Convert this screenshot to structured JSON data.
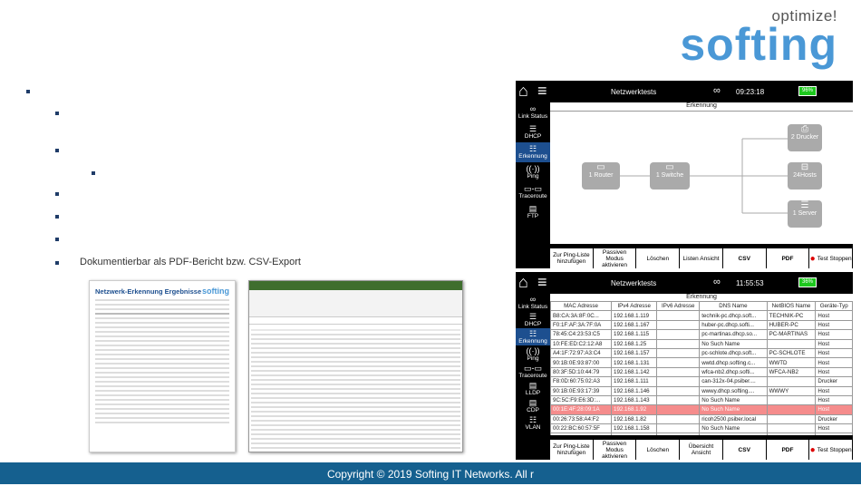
{
  "logo": {
    "tagline": "optimize!",
    "brand": "softing"
  },
  "slide": {
    "visible_bullet": "Dokumentierbar als PDF-Bericht bzw. CSV-Export"
  },
  "footer": {
    "text": "Copyright © 2019 Softing IT Networks. All r"
  },
  "report": {
    "title": "Netzwerk-Erkennung Ergebnisse",
    "brand": "softing"
  },
  "screen1": {
    "title": "Netzwerktests",
    "time": "09:23:18",
    "battery": "96%",
    "subtitle": "Erkennung",
    "sidebar": [
      "Link Status",
      "DHCP",
      "Erkennung",
      "Ping",
      "Traceroute",
      "FTP"
    ],
    "nodes": {
      "router": "1 Router",
      "switch": "1 Switche",
      "printer": "2 Drucker",
      "hosts": "24Hosts",
      "server": "1 Server"
    },
    "buttons": [
      "Zur Ping-Liste hinzufügen",
      "Passiven Modus aktivieren",
      "Löschen",
      "Listen Ansicht",
      "CSV",
      "PDF",
      "Test Stoppen"
    ]
  },
  "screen2": {
    "title": "Netzwerktests",
    "time": "11:55:53",
    "battery": "36%",
    "subtitle": "Erkennung",
    "sidebar": [
      "Link Status",
      "DHCP",
      "Erkennung",
      "Ping",
      "Traceroute",
      "LLDP",
      "CDP",
      "VLAN"
    ],
    "columns": [
      "MAC Adresse",
      "IPv4 Adresse",
      "IPv6 Adresse",
      "DNS Name",
      "NetBIOS Name",
      "Geräte-Typ"
    ],
    "rows": [
      [
        "B8:CA:3A:8F:0C...",
        "192.168.1.119",
        "",
        "technik-pc.dhcp.soft...",
        "TECHNIK-PC",
        "Host"
      ],
      [
        "F0:1F:AF:3A:7F:0A",
        "192.168.1.167",
        "",
        "huber-pc.dhcp.softi...",
        "HUBER-PC",
        "Host"
      ],
      [
        "78:45:C4:23:53:C5",
        "192.168.1.115",
        "",
        "pc-martinas.dhcp.so...",
        "PC-MARTINAS",
        "Host"
      ],
      [
        "10:FE:ED:C2:12:A8",
        "192.168.1.25",
        "",
        "No Such Name",
        "",
        "Host"
      ],
      [
        "A4:1F:72:97:A3:C4",
        "192.168.1.157",
        "",
        "pc-schlote.dhcp.soft...",
        "PC-SCHLOTE",
        "Host"
      ],
      [
        "90:1B:0E:93:87:00",
        "192.168.1.131",
        "",
        "wwtd.dhcp.softing.c...",
        "WWTD",
        "Host"
      ],
      [
        "80:3F:5D:10:44:79",
        "192.168.1.142",
        "",
        "wfca-nb2.dhcp.softi...",
        "WFCA-NB2",
        "Host"
      ],
      [
        "F8:0D:60:75:02:A3",
        "192.168.1.111",
        "",
        "can-312x-04.psiber....",
        "",
        "Drucker"
      ],
      [
        "90:1B:0E:93:17:39",
        "192.168.1.146",
        "",
        "wwwy.dhcp.softing....",
        "WWWY",
        "Host"
      ],
      [
        "9C:5C:F9:E6:3D:...",
        "192.168.1.143",
        "",
        "No Such Name",
        "",
        "Host"
      ],
      [
        "00:1E:4F:28:09:1A",
        "192.168.1.92",
        "",
        "No Such Name",
        "",
        "Host"
      ],
      [
        "00:26:73:58:A4:F2",
        "192.168.1.82",
        "",
        "ricoh2500.psiber.local",
        "",
        "Drucker"
      ],
      [
        "00:22:BC:60:57:5F",
        "192.168.1.158",
        "",
        "No Such Name",
        "",
        "Host"
      ],
      [
        "00:06:71:41:00:30",
        "192.168.1.170",
        "",
        "No Such Name",
        "",
        "Host"
      ]
    ],
    "buttons": [
      "Zur Ping-Liste hinzufügen",
      "Passiven Modus aktivieren",
      "Löschen",
      "Übersicht Ansicht",
      "CSV",
      "PDF",
      "Test Stoppen"
    ]
  }
}
